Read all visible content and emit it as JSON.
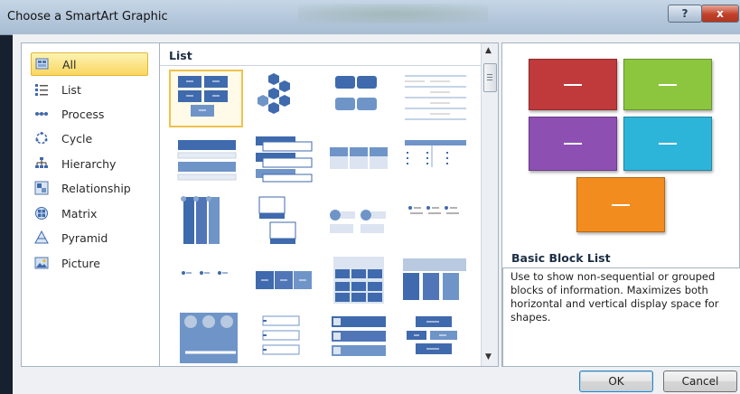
{
  "window": {
    "title": "Choose a SmartArt Graphic",
    "help_label": "?",
    "close_label": "x"
  },
  "categories": [
    {
      "label": "All",
      "icon": "all-icon",
      "selected": true
    },
    {
      "label": "List",
      "icon": "list-icon"
    },
    {
      "label": "Process",
      "icon": "process-icon"
    },
    {
      "label": "Cycle",
      "icon": "cycle-icon"
    },
    {
      "label": "Hierarchy",
      "icon": "hierarchy-icon"
    },
    {
      "label": "Relationship",
      "icon": "relationship-icon"
    },
    {
      "label": "Matrix",
      "icon": "matrix-icon"
    },
    {
      "label": "Pyramid",
      "icon": "pyramid-icon"
    },
    {
      "label": "Picture",
      "icon": "picture-icon"
    }
  ],
  "gallery": {
    "header": "List",
    "selected_index": 0,
    "layout_count": 20
  },
  "preview": {
    "title": "Basic Block List",
    "description": "Use to show non-sequential or grouped blocks of information. Maximizes both horizontal and vertical display space for shapes.",
    "colors": [
      "#c0393b",
      "#8cc63e",
      "#8e4fb3",
      "#2db4d9",
      "#f28c1f"
    ]
  },
  "buttons": {
    "ok": "OK",
    "cancel": "Cancel"
  },
  "colors": {
    "smartart_blue": "#3f6aad",
    "selection": "#f9d760"
  }
}
